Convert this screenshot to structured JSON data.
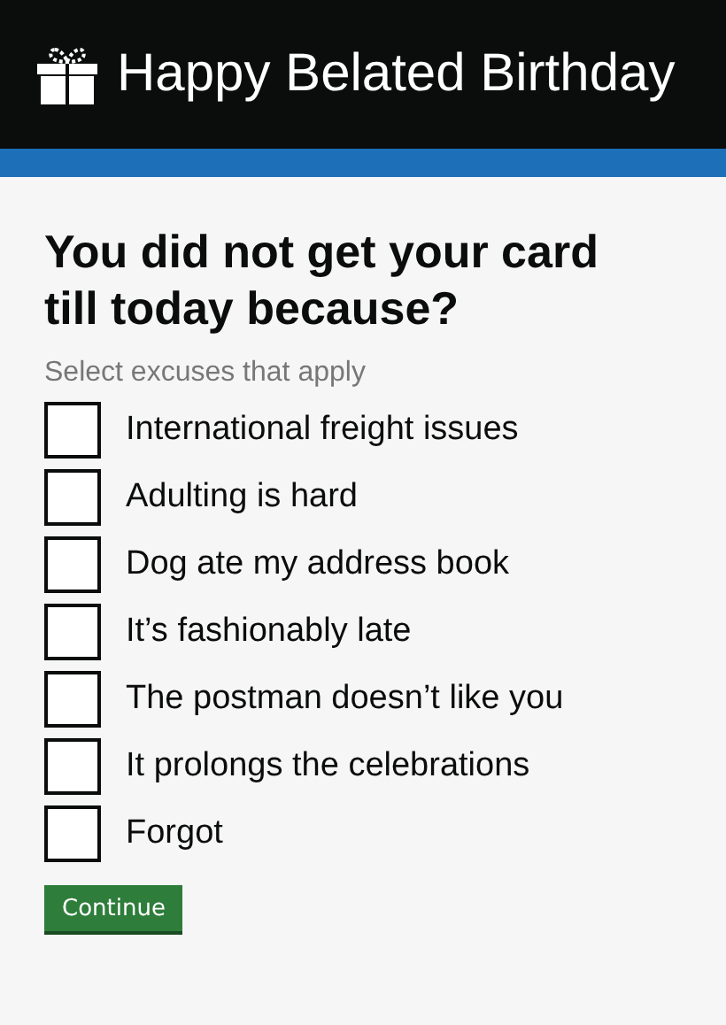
{
  "header": {
    "title": "Happy Belated Birthday"
  },
  "question": {
    "heading": "You did not get your card till today because?",
    "hint": "Select excuses that apply"
  },
  "options": [
    {
      "label": "International freight issues",
      "checked": false
    },
    {
      "label": "Adulting is hard",
      "checked": false
    },
    {
      "label": "Dog ate my address book",
      "checked": false
    },
    {
      "label": "It’s fashionably late",
      "checked": false
    },
    {
      "label": "The postman doesn’t like you",
      "checked": false
    },
    {
      "label": "It prolongs the celebrations",
      "checked": false
    },
    {
      "label": "Forgot",
      "checked": false
    }
  ],
  "button": {
    "label": "Continue"
  }
}
